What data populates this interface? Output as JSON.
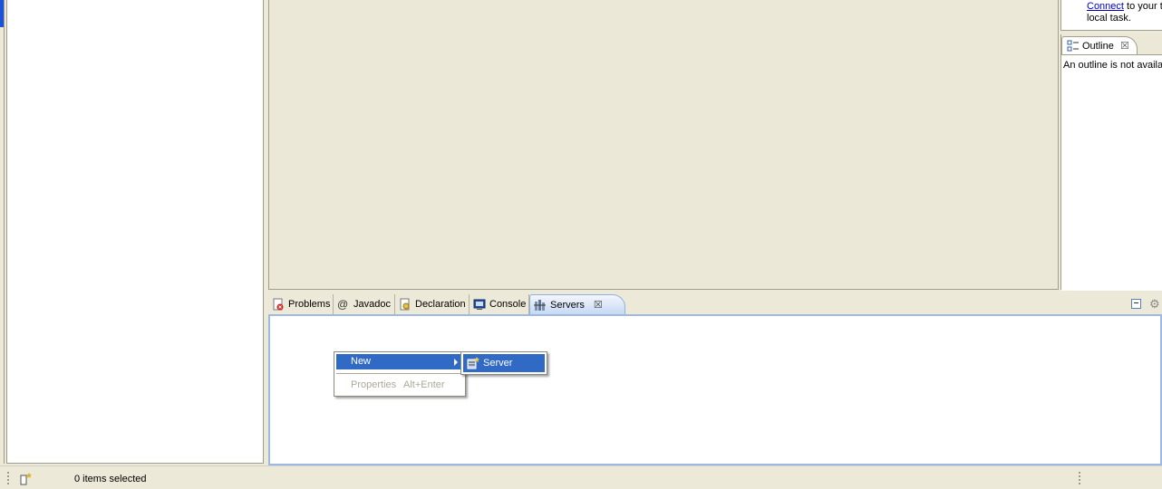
{
  "task_list": {
    "link_text": "Connect",
    "line1_rest": " to your t",
    "line2": "local task."
  },
  "outline": {
    "tab_label": "Outline",
    "close_glyph": "☒",
    "message": "An outline is not availa"
  },
  "bottom_tabs": {
    "problems": "Problems",
    "javadoc": "Javadoc",
    "declaration": "Declaration",
    "console": "Console",
    "servers": "Servers",
    "close_glyph": "☒"
  },
  "context_menu": {
    "new_label": "New",
    "properties_label": "Properties",
    "properties_accel": "Alt+Enter",
    "submenu": {
      "server_label": "Server"
    }
  },
  "status_bar": {
    "text": "0 items selected"
  },
  "colors": {
    "selection": "#316ac5",
    "active_tab_border": "#9db9e4",
    "background": "#ece9d8"
  }
}
